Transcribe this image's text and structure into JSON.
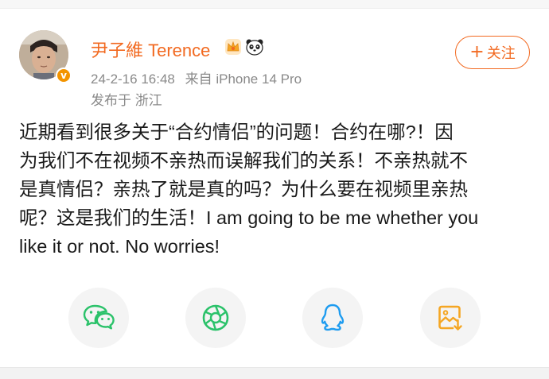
{
  "author": {
    "name": "尹子維 Terence",
    "verified": true
  },
  "meta": {
    "timestamp": "24-2-16 16:48",
    "source": "来自 iPhone 14 Pro",
    "location": "发布于 浙江"
  },
  "follow": {
    "icon": "+",
    "label": "关注"
  },
  "post": {
    "lines": [
      "近期看到很多关于“合约情侣”的问题！合约在哪?！因",
      "为我们不在视频不亲热而误解我们的关系！不亲热就不",
      "是真情侣？亲热了就是真的吗？为什么要在视频里亲热",
      "呢？这是我们的生活！I am going to be me whether you",
      "like it or not.  No worries!"
    ]
  },
  "share": {
    "items": [
      {
        "icon": "wechat-icon",
        "color": "#2bc26a"
      },
      {
        "icon": "moments-icon",
        "color": "#2bc26a"
      },
      {
        "icon": "qq-icon",
        "color": "#1e9cf0"
      },
      {
        "icon": "save-image-icon",
        "color": "#f5a623"
      }
    ]
  },
  "colors": {
    "accent": "#f26a21",
    "meta_text": "#8a8a8a",
    "body_text": "#1a1a1a",
    "share_bg": "#f4f4f4",
    "badge": "#f39400"
  }
}
